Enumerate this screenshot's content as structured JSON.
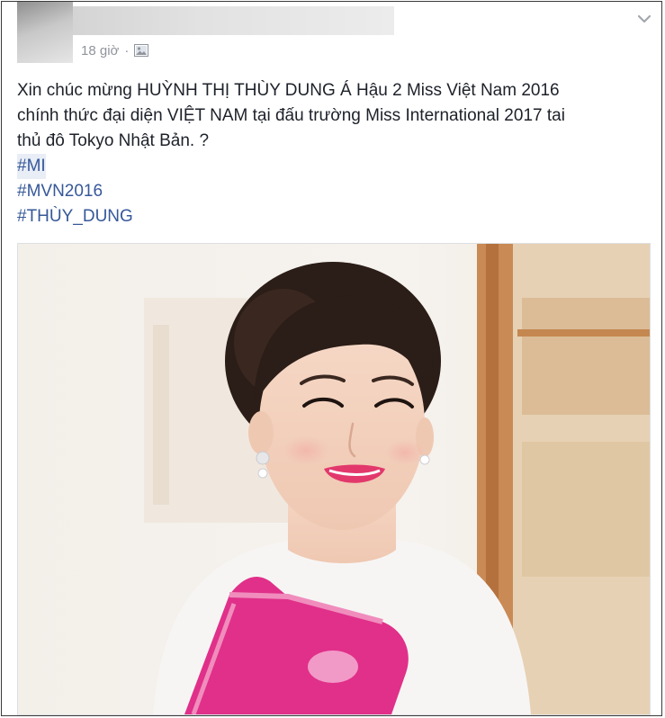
{
  "post": {
    "timestamp": "18 giờ",
    "separator": "·",
    "audience_icon": "photo-icon",
    "menu_icon": "chevron-down-icon",
    "text_lines": [
      "Xin chúc mừng HUỲNH THỊ THÙY DUNG Á Hậu 2 Miss Việt Nam 2016",
      "chính thức đại diện VIỆT NAM tại đấu trường Miss International 2017 tai",
      "thủ đô Tokyo Nhật Bản. ?"
    ],
    "hashtags": [
      "#MI",
      "#MVN2016",
      "#THÙY_DUNG"
    ],
    "photo_description_icon": "photo"
  },
  "colors": {
    "text": "#1d2129",
    "hashtag": "#365899",
    "meta": "#90949c",
    "sash": "#e0308a"
  }
}
